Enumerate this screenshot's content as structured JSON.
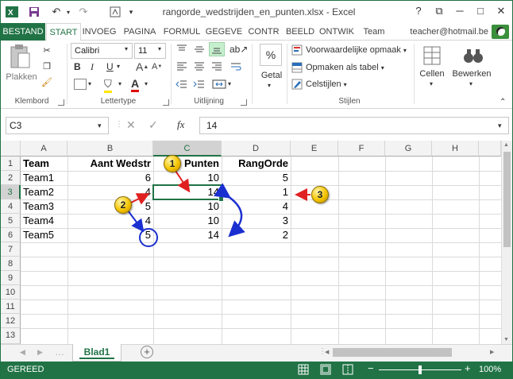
{
  "window": {
    "title": "rangorde_wedstrijden_en_punten.xlsx - Excel",
    "help": "?",
    "minimize": "─",
    "restore": "□",
    "close": "✕"
  },
  "tabs": [
    {
      "label": "BESTAND"
    },
    {
      "label": "START"
    },
    {
      "label": "INVOEG"
    },
    {
      "label": "PAGINA"
    },
    {
      "label": "FORMUL"
    },
    {
      "label": "GEGEVE"
    },
    {
      "label": "CONTR"
    },
    {
      "label": "BEELD"
    },
    {
      "label": "ONTWIK"
    },
    {
      "label": "Team"
    }
  ],
  "account": "teacher@hotmail.be",
  "ribbon": {
    "clipboard": {
      "paste": "Plakken",
      "group": "Klembord"
    },
    "font": {
      "name": "Calibri",
      "size": "11",
      "group": "Lettertype",
      "bold": "B",
      "italic": "I",
      "underline": "U"
    },
    "alignment": {
      "group": "Uitlijning"
    },
    "number": {
      "label": "Getal",
      "percent": "%"
    },
    "styles": {
      "conditional": "Voorwaardelijke opmaak",
      "table": "Opmaken als tabel",
      "cell_styles": "Celstijlen",
      "group": "Stijlen"
    },
    "cells": {
      "label": "Cellen"
    },
    "editing": {
      "label": "Bewerken"
    }
  },
  "formula_bar": {
    "name_box": "C3",
    "fx": "fx",
    "value": "14"
  },
  "columns": [
    "A",
    "B",
    "C",
    "D",
    "E",
    "F",
    "G",
    "H"
  ],
  "rows": [
    "1",
    "2",
    "3",
    "4",
    "5",
    "6",
    "7",
    "8",
    "9",
    "10",
    "11",
    "12",
    "13"
  ],
  "sheet": {
    "headers": [
      "Team",
      "Aant Wedstr",
      "Punten",
      "RangOrde"
    ],
    "data": [
      [
        "Team1",
        "6",
        "10",
        "5"
      ],
      [
        "Team2",
        "4",
        "14",
        "1"
      ],
      [
        "Team3",
        "5",
        "10",
        "4"
      ],
      [
        "Team4",
        "4",
        "10",
        "3"
      ],
      [
        "Team5",
        "5",
        "14",
        "2"
      ]
    ]
  },
  "sheet_tab": "Blad1",
  "status": {
    "ready": "GEREED",
    "zoom": "100%"
  },
  "annotations": {
    "badge1": "1",
    "badge2": "2",
    "badge3": "3"
  }
}
